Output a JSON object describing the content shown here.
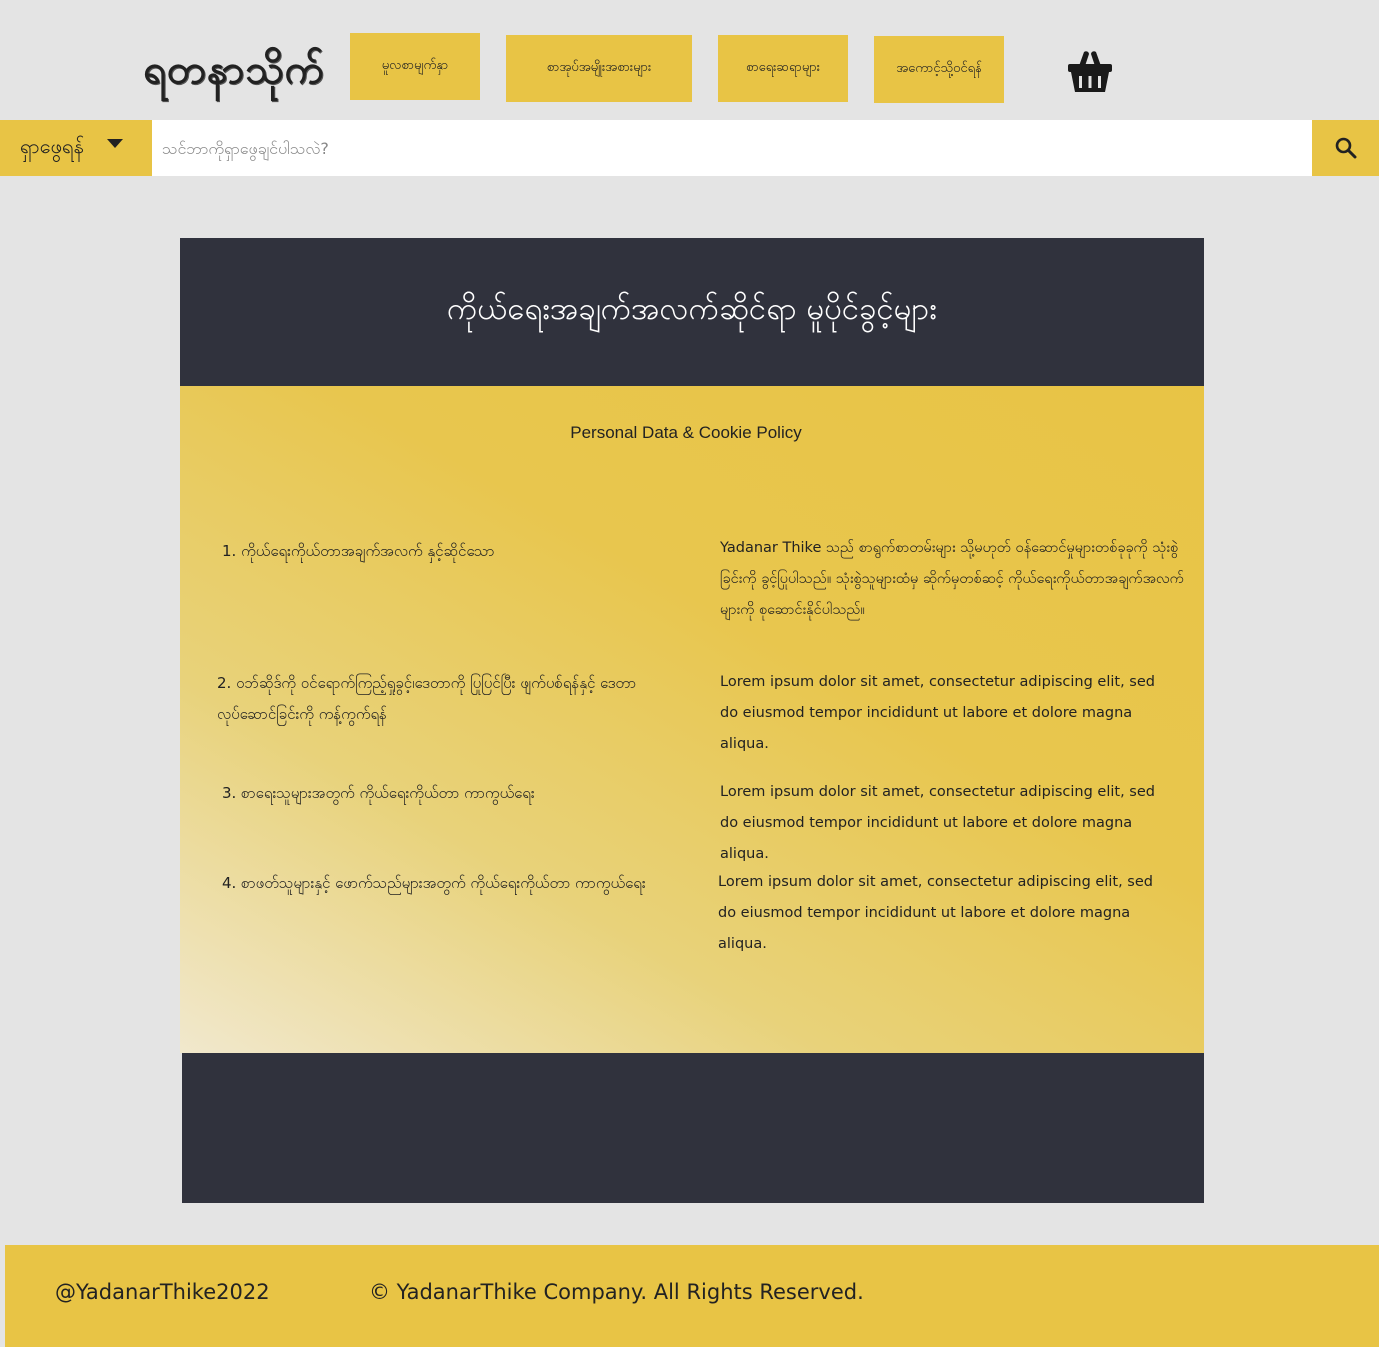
{
  "header": {
    "logo": "ရတနာသိုက်",
    "nav": [
      {
        "label": "မူလစာမျက်နှာ"
      },
      {
        "label": "စာအုပ်အမျိုးအစားများ"
      },
      {
        "label": "စာရေးဆရာများ"
      },
      {
        "label": "အကောင့်သို့ဝင်ရန်"
      }
    ],
    "cart_icon": "basket-icon"
  },
  "search": {
    "category_label": "ရှာဖွေရန်",
    "placeholder": "သင်ဘာကိုရှာဖွေချင်ပါသလဲ?",
    "value": "",
    "button_icon": "search-icon"
  },
  "policy": {
    "title": "ကိုယ်ရေးအချက်အလက်ဆိုင်ရာ မူပိုင်ခွင့်များ",
    "subtitle": "Personal Data & Cookie Policy",
    "items": [
      {
        "heading": "1. ကိုယ်ရေးကိုယ်တာအချက်အလက် နှင့်ဆိုင်သော",
        "body": "Yadanar Thike သည် စာရွက်စာတမ်းများ သို့မဟုတ် ဝန်ဆောင်မှုများတစ်ခုခုကို သုံးစွဲခြင်းကို ခွင့်ပြုပါသည်။ သုံးစွဲသူများထံမှ ဆိုက်မှတစ်ဆင့် ကိုယ်ရေးကိုယ်တာအချက်အလက်များကို စုဆောင်းနိုင်ပါသည်။"
      },
      {
        "heading": "2. ဝဘ်ဆိုဒ်ကို ဝင်ရောက်ကြည့်ရှုခွင့်၊ဒေတာကို ပြုပြင်ပြီး ဖျက်ပစ်ရန်နှင့် ဒေတာလုပ်ဆောင်ခြင်းကို ကန့်ကွက်ရန်",
        "body": "Lorem ipsum dolor sit amet, consectetur adipiscing elit, sed do eiusmod tempor incididunt ut labore et dolore magna aliqua."
      },
      {
        "heading": "3. စာရေးသူများအတွက် ကိုယ်ရေးကိုယ်တာ ကာကွယ်ရေး",
        "body": "Lorem ipsum dolor sit amet, consectetur adipiscing elit, sed do eiusmod tempor incididunt ut labore et dolore magna aliqua."
      },
      {
        "heading": "4. စာဖတ်သူများနှင့် ဖောက်သည်များအတွက် ကိုယ်ရေးကိုယ်တာ ကာကွယ်ရေး",
        "body": "Lorem ipsum dolor sit amet, consectetur adipiscing elit, sed do eiusmod tempor incididunt ut labore et dolore magna aliqua."
      }
    ]
  },
  "footer": {
    "handle": "@YadanarThike2022",
    "copyright": "© YadanarThike Company. All Rights Reserved."
  },
  "colors": {
    "accent": "#e8c445",
    "dark": "#30323d",
    "background": "#e4e4e4"
  }
}
